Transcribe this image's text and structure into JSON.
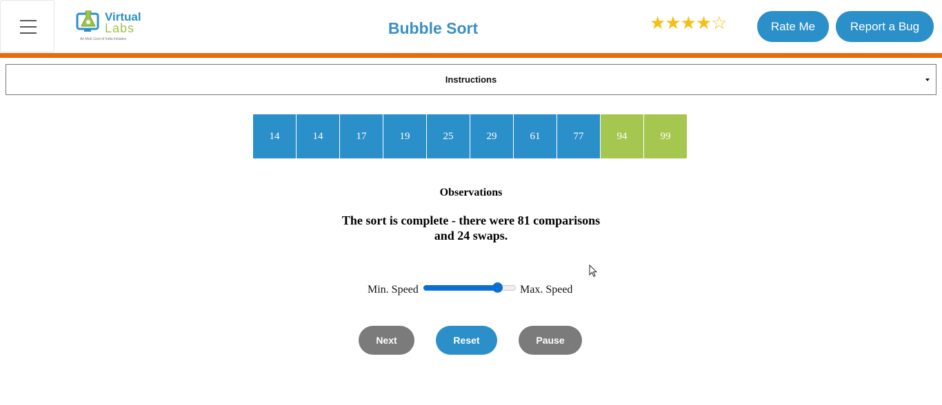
{
  "header": {
    "menu_icon": "hamburger-icon",
    "logo": {
      "line1": "Virtual",
      "line2": "Labs",
      "tagline": "An MoE Govt of India Initiative"
    },
    "title": "Bubble Sort",
    "rating": {
      "value": 4,
      "max": 5,
      "filled": "★★★★",
      "empty": "☆"
    },
    "rate_label": "Rate Me",
    "bug_label": "Report a Bug"
  },
  "instructions": {
    "label": "Instructions",
    "icon": "caret-down-icon"
  },
  "array": {
    "values": [
      "14",
      "14",
      "17",
      "19",
      "25",
      "29",
      "61",
      "77",
      "94",
      "99"
    ],
    "sorted_count": 2,
    "colors": {
      "unsorted": "#2b8fc9",
      "sorted": "#a6c74f"
    }
  },
  "observations": {
    "title": "Observations",
    "line1": "The sort is complete - there were 81 comparisons",
    "line2": "and 24 swaps."
  },
  "speed": {
    "min_label": "Min. Speed",
    "max_label": "Max. Speed",
    "value": 0.8
  },
  "controls": {
    "next_label": "Next",
    "reset_label": "Reset",
    "pause_label": "Pause"
  },
  "colors": {
    "accent": "#2b8fc9",
    "header_bar": "#ea6b0d",
    "disabled": "#7b7b7b",
    "star": "#f3c014"
  }
}
